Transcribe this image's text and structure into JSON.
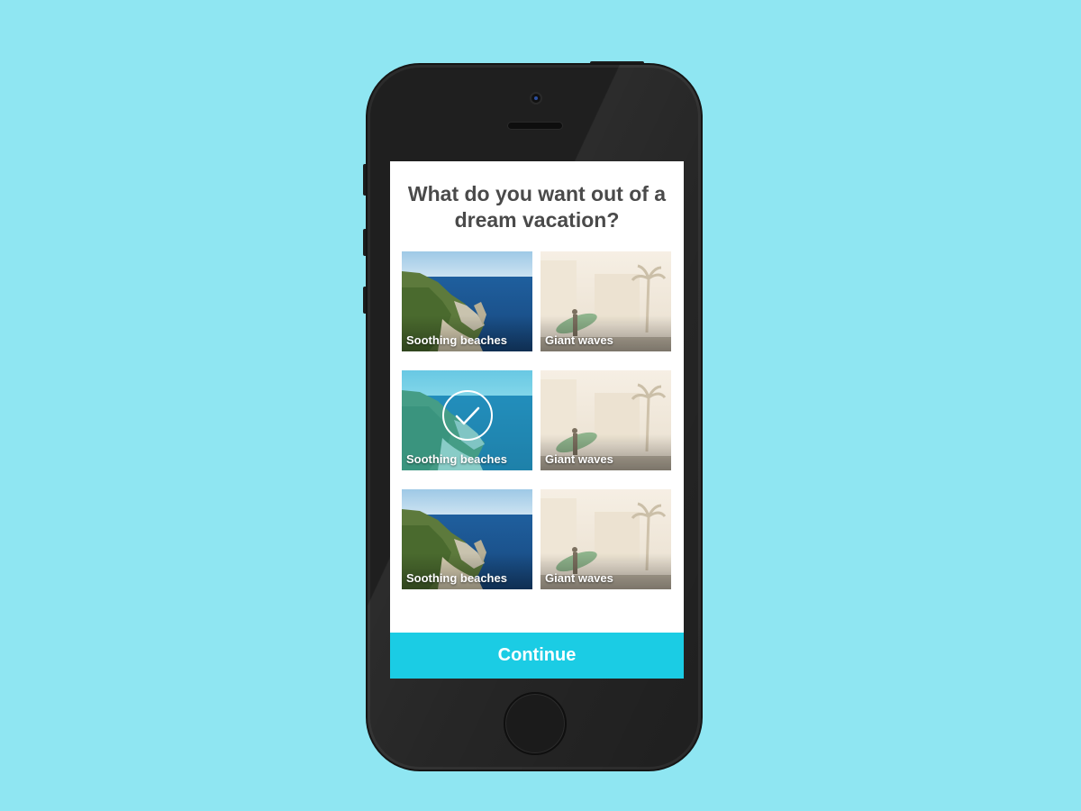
{
  "question": "What do you want out of a dream vacation?",
  "tiles": [
    {
      "label": "Soothing beaches",
      "image": "coastal-cliffs-photo",
      "selected": false
    },
    {
      "label": "Giant waves",
      "image": "surfer-palm-photo",
      "selected": false
    },
    {
      "label": "Soothing beaches",
      "image": "coastal-cliffs-photo",
      "selected": true
    },
    {
      "label": "Giant waves",
      "image": "surfer-palm-photo",
      "selected": false
    },
    {
      "label": "Soothing beaches",
      "image": "coastal-cliffs-photo",
      "selected": false
    },
    {
      "label": "Giant waves",
      "image": "surfer-palm-photo",
      "selected": false
    }
  ],
  "continue_label": "Continue",
  "colors": {
    "background": "#8fe6f2",
    "accent": "#1bcce4",
    "heading": "#4a4a4a"
  },
  "icons": {
    "selected": "checkmark-circle-icon"
  }
}
